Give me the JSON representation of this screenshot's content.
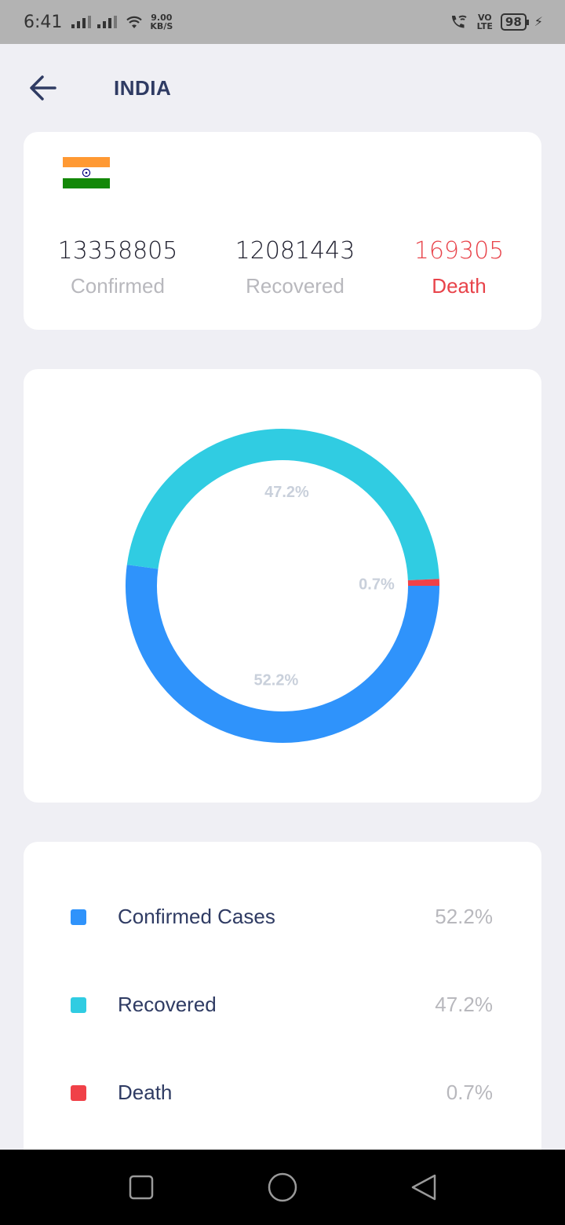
{
  "status_bar": {
    "time": "6:41",
    "net_speed_value": "9.00",
    "net_speed_unit": "KB/S",
    "volte_top": "VO",
    "volte_bottom": "LTE",
    "battery": "98"
  },
  "header": {
    "title": "INDIA",
    "back_icon": "arrow-left-icon"
  },
  "stats": {
    "confirmed_value": "13358805",
    "confirmed_label": "Confirmed",
    "recovered_value": "12081443",
    "recovered_label": "Recovered",
    "death_value": "169305",
    "death_label": "Death"
  },
  "colors": {
    "confirmed": "#2f93fb",
    "recovered": "#30cce2",
    "death": "#f04148",
    "title": "#2f3b63",
    "muted": "#b8b8bd",
    "slice_label": "#c9d0db"
  },
  "chart_data": {
    "type": "pie",
    "variant": "donut",
    "categories": [
      "Confirmed Cases",
      "Recovered",
      "Death"
    ],
    "values": [
      52.2,
      47.2,
      0.7
    ],
    "labels": [
      "52.2%",
      "47.2%",
      "0.7%"
    ],
    "colors": [
      "#2f93fb",
      "#30cce2",
      "#f04148"
    ]
  },
  "legend": [
    {
      "label": "Confirmed Cases",
      "value": "52.2%",
      "color": "#2f93fb"
    },
    {
      "label": "Recovered",
      "value": "47.2%",
      "color": "#30cce2"
    },
    {
      "label": "Death",
      "value": "0.7%",
      "color": "#f04148"
    }
  ],
  "nav": {
    "recent_icon": "square-icon",
    "home_icon": "circle-icon",
    "back_icon": "triangle-back-icon"
  }
}
